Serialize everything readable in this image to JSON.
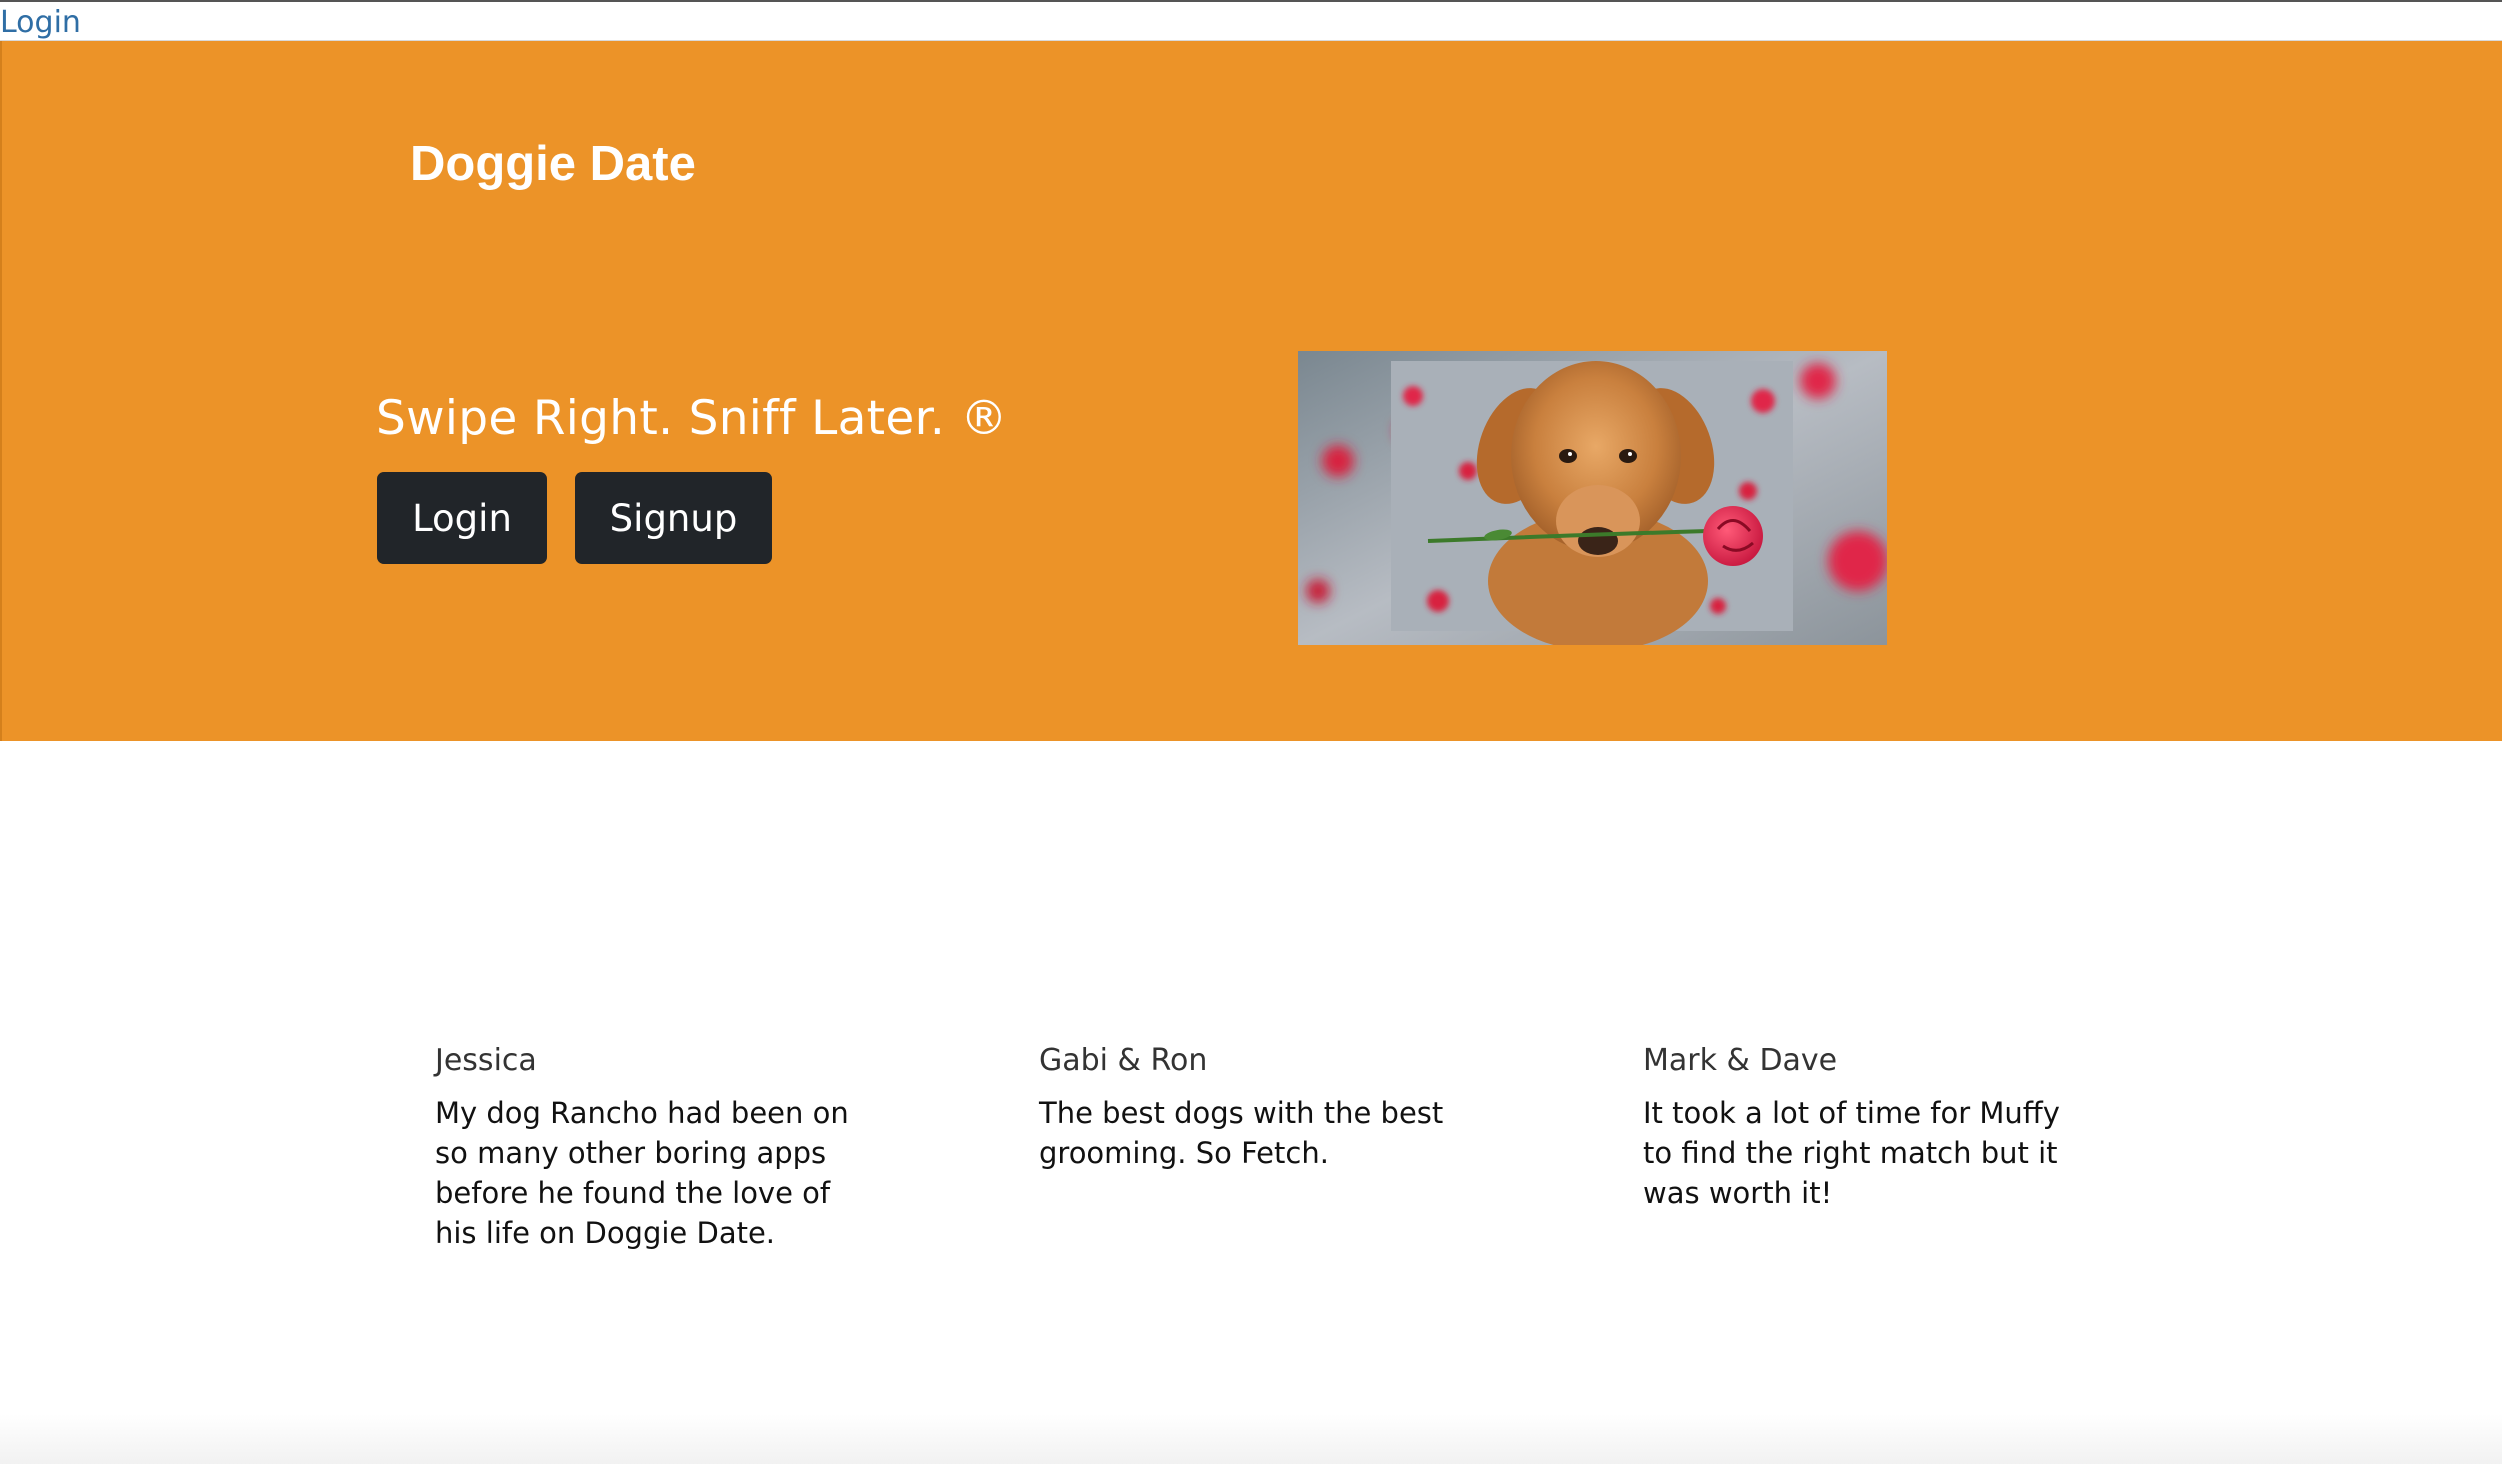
{
  "topbar": {
    "login_link": "Login"
  },
  "hero": {
    "brand": "Doggie Date",
    "tagline": "Swipe Right. Sniff Later. ®",
    "login_button": "Login",
    "signup_button": "Signup",
    "background_color": "#ec9328",
    "button_color": "#212529"
  },
  "testimonials": [
    {
      "name": "Jessica",
      "text": "My dog Rancho had been on so many other boring apps before he found the love of his life on Doggie Date."
    },
    {
      "name": "Gabi & Ron",
      "text": "The best dogs with the best grooming. So Fetch."
    },
    {
      "name": "Mark & Dave",
      "text": "It took a lot of time for Muffy to find the right match but it was worth it!"
    }
  ]
}
